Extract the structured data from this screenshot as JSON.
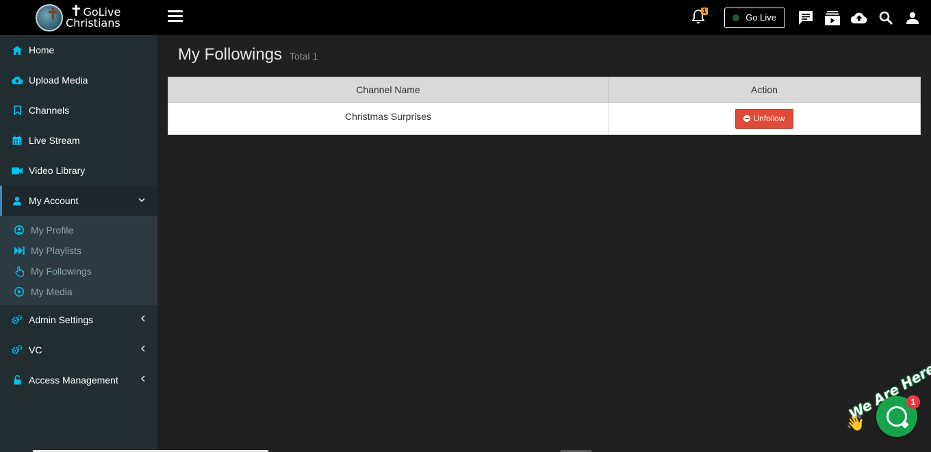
{
  "brand": {
    "name_line1": "GoLive",
    "name_line2": "Christians"
  },
  "sidebar": {
    "items": [
      {
        "label": "Home",
        "icon": "home-icon"
      },
      {
        "label": "Upload Media",
        "icon": "cloud-upload-icon"
      },
      {
        "label": "Channels",
        "icon": "bookmark-icon"
      },
      {
        "label": "Live Stream",
        "icon": "calendar-icon"
      },
      {
        "label": "Video Library",
        "icon": "video-camera-icon"
      },
      {
        "label": "My Account",
        "icon": "user-icon"
      }
    ],
    "submenu": [
      {
        "label": "My Profile",
        "icon": "user-circle-icon"
      },
      {
        "label": "My Playlists",
        "icon": "fast-forward-icon"
      },
      {
        "label": "My Followings",
        "icon": "hand-pointer-icon"
      },
      {
        "label": "My Media",
        "icon": "play-circle-icon"
      }
    ],
    "bottom_items": [
      {
        "label": "Admin Settings",
        "icon": "gears-icon"
      },
      {
        "label": "VC",
        "icon": "gears-icon"
      },
      {
        "label": "Access Management",
        "icon": "unlock-icon"
      }
    ]
  },
  "topbar": {
    "notification_count": "1",
    "go_live_label": "Go Live"
  },
  "page": {
    "title": "My Followings",
    "total_label": "Total 1"
  },
  "table": {
    "headers": [
      "Channel Name",
      "Action"
    ],
    "rows": [
      {
        "channel_name": "Christmas Surprises",
        "action_label": "Unfollow"
      }
    ]
  },
  "chat": {
    "banner": "We Are Here!",
    "badge": "1"
  },
  "colors": {
    "sidebar_bg": "#222d32",
    "accent": "#3c8dbc",
    "icon_blue": "#00c0ef",
    "unfollow_red": "#dd4b39",
    "chat_green": "#17a34a"
  }
}
